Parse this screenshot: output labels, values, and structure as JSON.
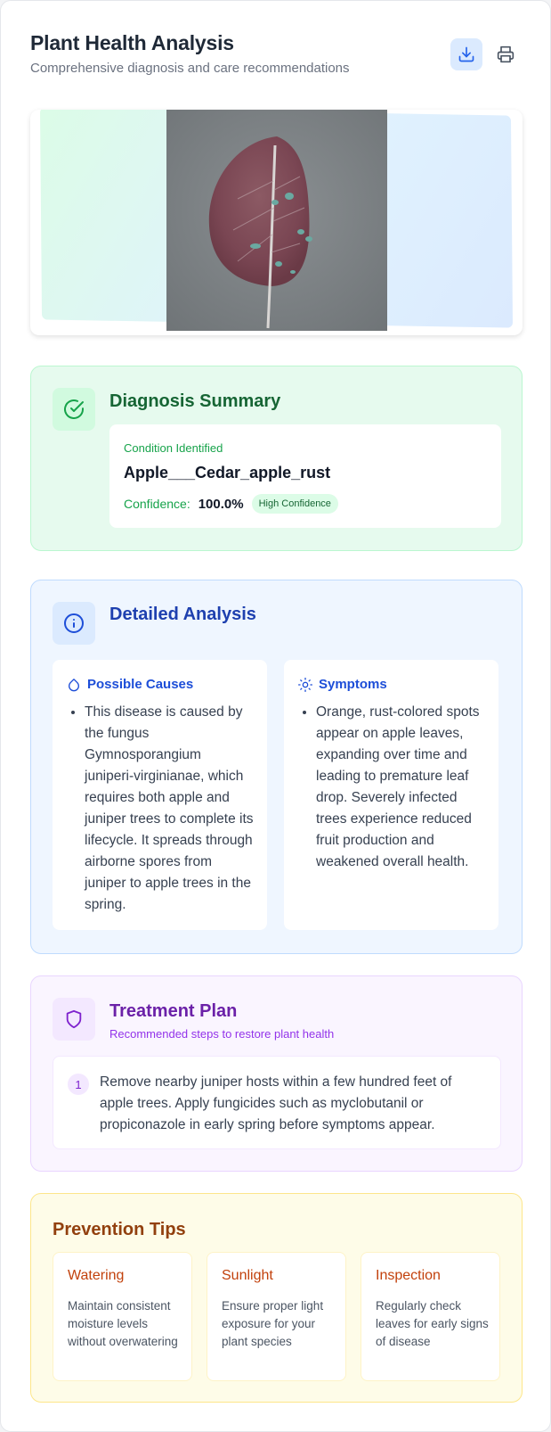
{
  "header": {
    "title": "Plant Health Analysis",
    "subtitle": "Comprehensive diagnosis and care recommendations",
    "actions": [
      {
        "icon": "download-icon"
      },
      {
        "icon": "printer-icon"
      }
    ]
  },
  "image": {
    "subject": "apple leaf with rust spots"
  },
  "diagnosis": {
    "title": "Diagnosis Summary",
    "icon": "check-circle-icon",
    "condition_label": "Condition Identified",
    "condition_value": "Apple___Cedar_apple_rust",
    "confidence_label": "Confidence:",
    "confidence_value": "100.0%",
    "confidence_badge": "High Confidence"
  },
  "analysis": {
    "title": "Detailed Analysis",
    "icon": "info-icon",
    "causes": {
      "title": "Possible Causes",
      "icon": "droplet-icon",
      "items": [
        "This disease is caused by the fungus Gymnosporangium juniperi-virginianae, which requires both apple and juniper trees to complete its lifecycle. It spreads through airborne spores from juniper to apple trees in the spring."
      ]
    },
    "symptoms": {
      "title": "Symptoms",
      "icon": "sun-icon",
      "items": [
        "Orange, rust-colored spots appear on apple leaves, expanding over time and leading to premature leaf drop. Severely infected trees experience reduced fruit production and weakened overall health."
      ]
    }
  },
  "treatment": {
    "title": "Treatment Plan",
    "subtitle": "Recommended steps to restore plant health",
    "icon": "shield-icon",
    "steps": [
      {
        "number": "1",
        "text": "Remove nearby juniper hosts within a few hundred feet of apple trees. Apply fungicides such as myclobutanil or propiconazole in early spring before symptoms appear."
      }
    ]
  },
  "prevention": {
    "title": "Prevention Tips",
    "tips": [
      {
        "title": "Watering",
        "text": "Maintain consistent moisture levels without overwatering"
      },
      {
        "title": "Sunlight",
        "text": "Ensure proper light exposure for your plant species"
      },
      {
        "title": "Inspection",
        "text": "Regularly check leaves for early signs of disease"
      }
    ]
  },
  "colors": {
    "green_accent": "#16a34a",
    "blue_accent": "#1d4ed8",
    "purple_accent": "#7e22ce",
    "amber_accent": "#c2410c"
  }
}
